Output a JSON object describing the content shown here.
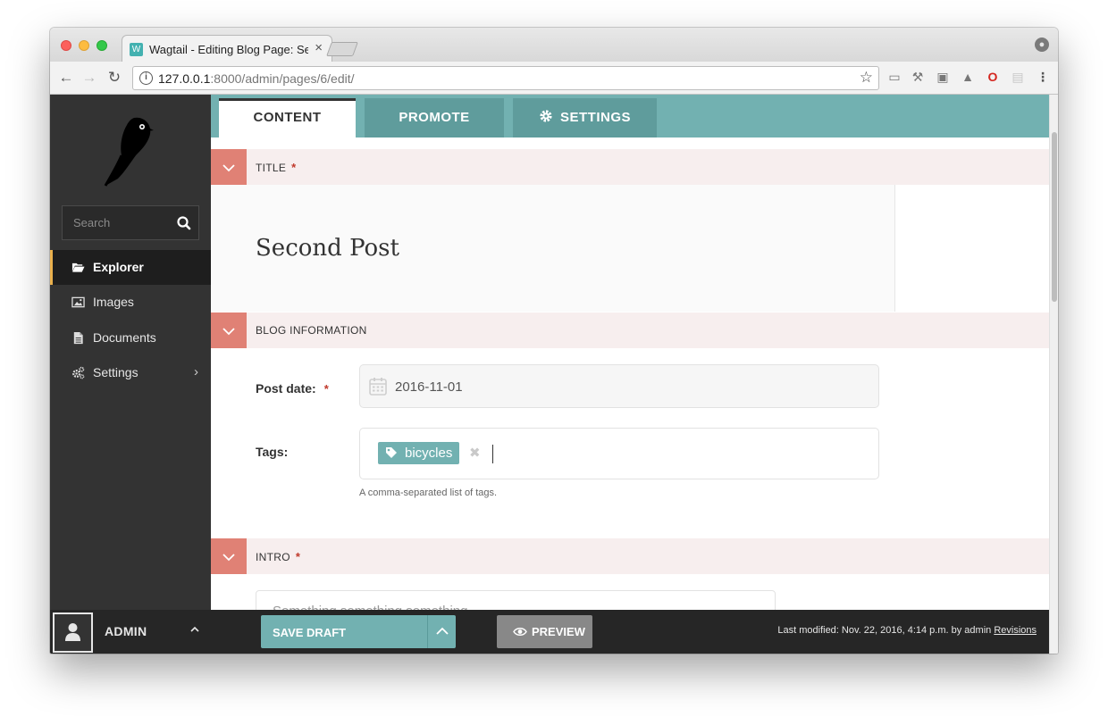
{
  "browser": {
    "tab_title": "Wagtail - Editing Blog Page: Se",
    "url_host": "127.0.0.1",
    "url_rest": ":8000/admin/pages/6/edit/",
    "icons": [
      "back-icon",
      "forward-icon",
      "reload-icon",
      "info-icon",
      "star-icon",
      "cast-icon",
      "wrench-icon",
      "camera-icon",
      "warning-icon",
      "opera-icon",
      "extension-icon",
      "menu-icon",
      "profile-icon"
    ]
  },
  "sidebar": {
    "search_placeholder": "Search",
    "items": [
      {
        "label": "Explorer",
        "icon": "folder-open-icon",
        "active": true
      },
      {
        "label": "Images",
        "icon": "image-icon"
      },
      {
        "label": "Documents",
        "icon": "document-icon"
      },
      {
        "label": "Settings",
        "icon": "cogs-icon",
        "has_submenu": true
      }
    ],
    "account_name": "ADMIN"
  },
  "tabs": [
    {
      "label": "CONTENT",
      "active": true
    },
    {
      "label": "PROMOTE"
    },
    {
      "label": "SETTINGS",
      "icon": "gear-icon"
    }
  ],
  "panels": {
    "title": {
      "label": "TITLE",
      "required": "*",
      "value": "Second Post"
    },
    "blog_info": {
      "label": "BLOG INFORMATION",
      "post_date_label": "Post date:",
      "post_date_required": "*",
      "post_date_value": "2016-11-01",
      "tags_label": "Tags:",
      "tags": [
        "bicycles"
      ],
      "tags_help": "A comma-separated list of tags."
    },
    "intro": {
      "label": "INTRO",
      "required": "*",
      "value": "Something something something..."
    }
  },
  "footer": {
    "save_label": "SAVE DRAFT",
    "preview_label": "PREVIEW",
    "last_modified": "Last modified: Nov. 22, 2016, 4:14 p.m. by admin",
    "revisions_label": "Revisions"
  },
  "colors": {
    "accent": "#72b1b1",
    "panel_toggle": "#e08175",
    "sidebar": "#333333"
  }
}
